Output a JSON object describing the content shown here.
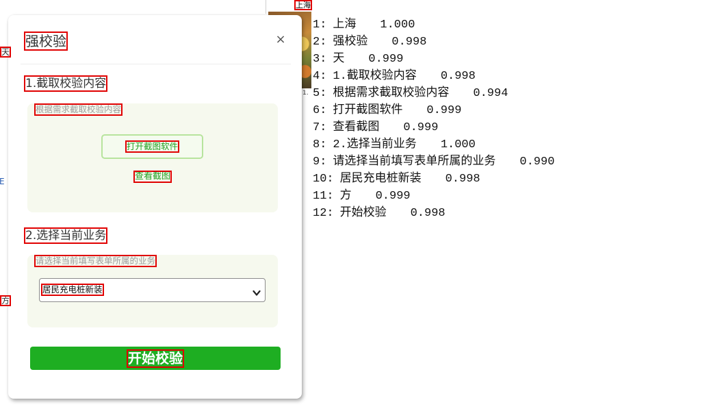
{
  "background_page": {
    "top_label": "上海",
    "edge_char_top": "天",
    "edge_char_blue": "E",
    "edge_char_bottom": "方",
    "small_number": "1."
  },
  "dialog": {
    "title": "强校验",
    "close_label": "×",
    "close_icon": "close-icon",
    "capture_section": {
      "heading": "1.截取校验内容",
      "hint": "根据需求截取校验内容",
      "open_tool_button": "打开截图软件",
      "view_screenshot_link": "查看截图"
    },
    "business_section": {
      "heading": "2.选择当前业务",
      "hint": "请选择当前填写表单所属的业务",
      "business_select": {
        "selected": "居民充电桩新装",
        "icon": "chevron-down-icon"
      }
    },
    "start_button": "开始校验"
  },
  "ocr_results": [
    {
      "index": "1:",
      "text": "上海",
      "score": "1.000"
    },
    {
      "index": "2:",
      "text": "强校验",
      "score": "0.998"
    },
    {
      "index": "3:",
      "text": "天",
      "score": "0.999"
    },
    {
      "index": "4:",
      "text": "1.截取校验内容",
      "score": "0.998"
    },
    {
      "index": "5:",
      "text": "根据需求截取校验内容",
      "score": "0.994"
    },
    {
      "index": "6:",
      "text": "打开截图软件",
      "score": "0.999"
    },
    {
      "index": "7:",
      "text": "查看截图",
      "score": "0.999"
    },
    {
      "index": "8:",
      "text": "2.选择当前业务",
      "score": "1.000"
    },
    {
      "index": "9:",
      "text": "请选择当前填写表单所属的业务",
      "score": "0.990"
    },
    {
      "index": "10:",
      "text": "居民充电桩新装",
      "score": "0.998"
    },
    {
      "index": "11:",
      "text": "方",
      "score": "0.999"
    },
    {
      "index": "12:",
      "text": "开始校验",
      "score": "0.998"
    }
  ],
  "colors": {
    "primary_green": "#1eae22",
    "link_green": "#23a123",
    "button_border_green": "#b7e49d",
    "panel_background": "#f6f9ee",
    "detection_box_red": "#e00000",
    "edge_text_blue": "#2b5fb3"
  }
}
